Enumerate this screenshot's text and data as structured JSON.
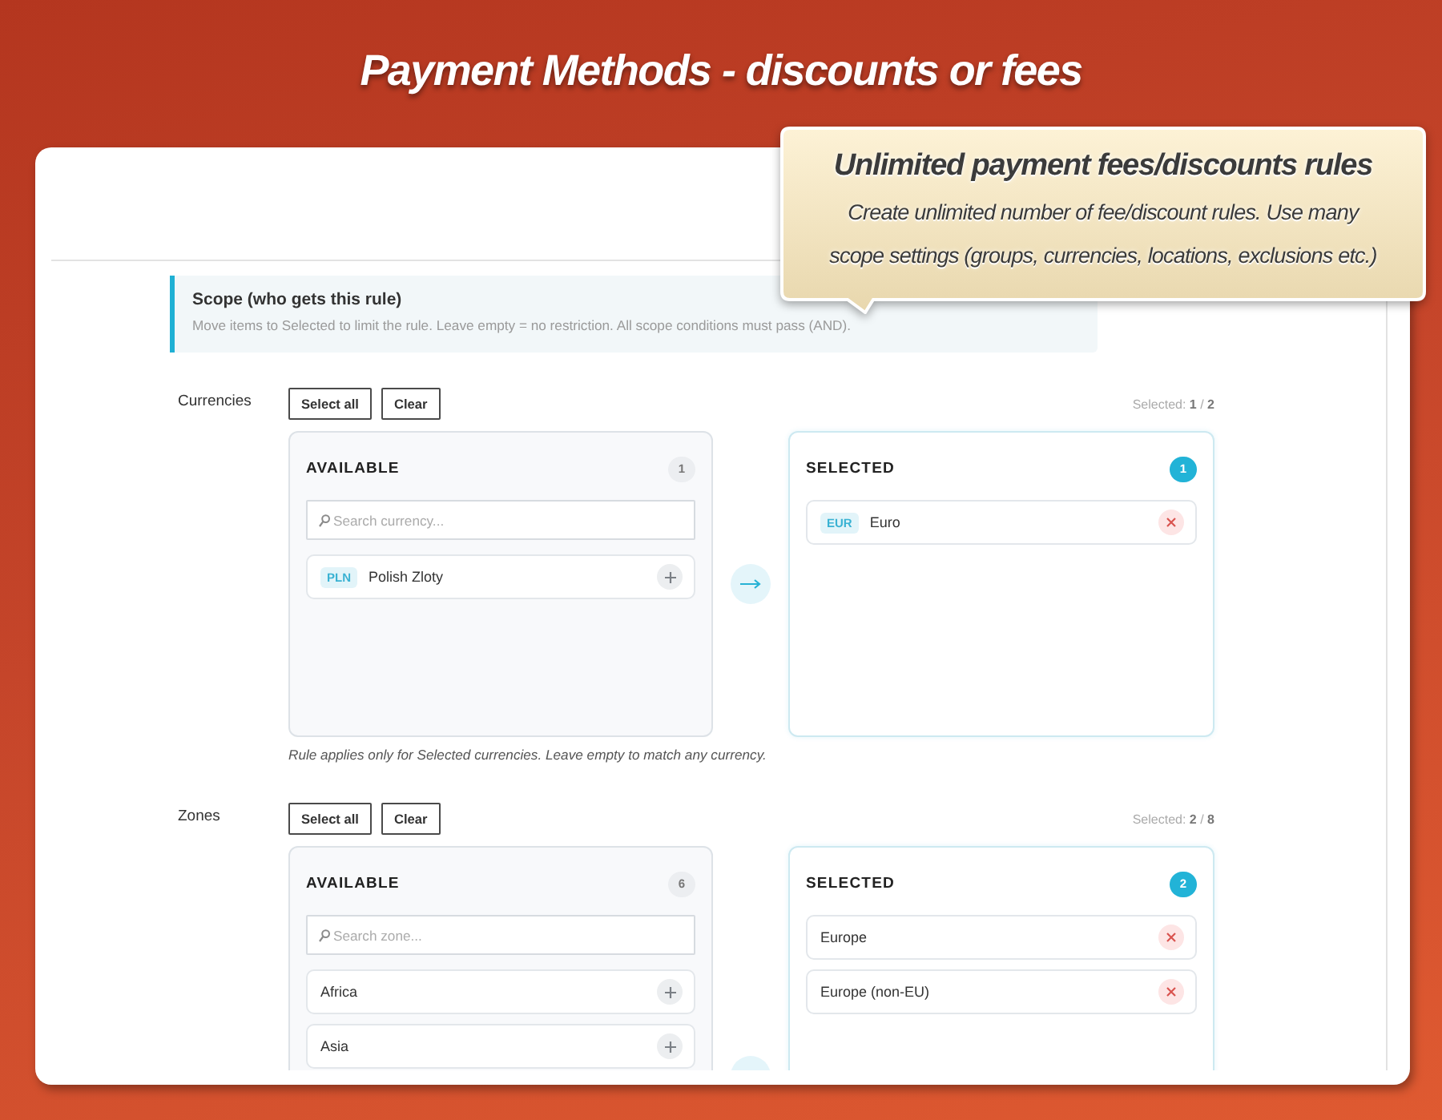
{
  "title": "Payment Methods - discounts or fees",
  "callout": {
    "title": "Unlimited payment fees/discounts rules",
    "text": "Create unlimited number of fee/discount rules. Use many scope settings (groups, currencies, locations, exclusions etc.)"
  },
  "scope": {
    "title": "Scope (who gets this rule)",
    "text": "Move items to Selected to limit the rule. Leave empty = no restriction. All scope conditions must pass (AND)."
  },
  "sections": [
    {
      "label": "Currencies",
      "buttons": [
        "Select all",
        "Clear"
      ],
      "selected_count": "Selected: **1** / **2**",
      "available": {
        "title": "AVAILABLE",
        "count": "1",
        "search": {
          "placeholder": "Search currency..."
        },
        "items": [
          {
            "code": "PLN",
            "name": "Polish Zloty"
          }
        ]
      },
      "selected": {
        "title": "SELECTED",
        "count": "1",
        "items": [
          {
            "code": "EUR",
            "name": "Euro"
          }
        ]
      },
      "hint": "Rule applies only for Selected currencies. Leave empty to match any currency."
    },
    {
      "label": "Zones",
      "buttons": [
        "Select all",
        "Clear"
      ],
      "selected_count": "Selected: **2** / **8**",
      "available": {
        "title": "AVAILABLE",
        "count": "6",
        "search": {
          "placeholder": "Search zone..."
        },
        "items": [
          {
            "name": "Africa"
          },
          {
            "name": "Asia"
          }
        ]
      },
      "selected": {
        "title": "SELECTED",
        "count": "2",
        "items": [
          {
            "name": "Europe"
          },
          {
            "name": "Europe (non-EU)"
          }
        ]
      }
    }
  ]
}
